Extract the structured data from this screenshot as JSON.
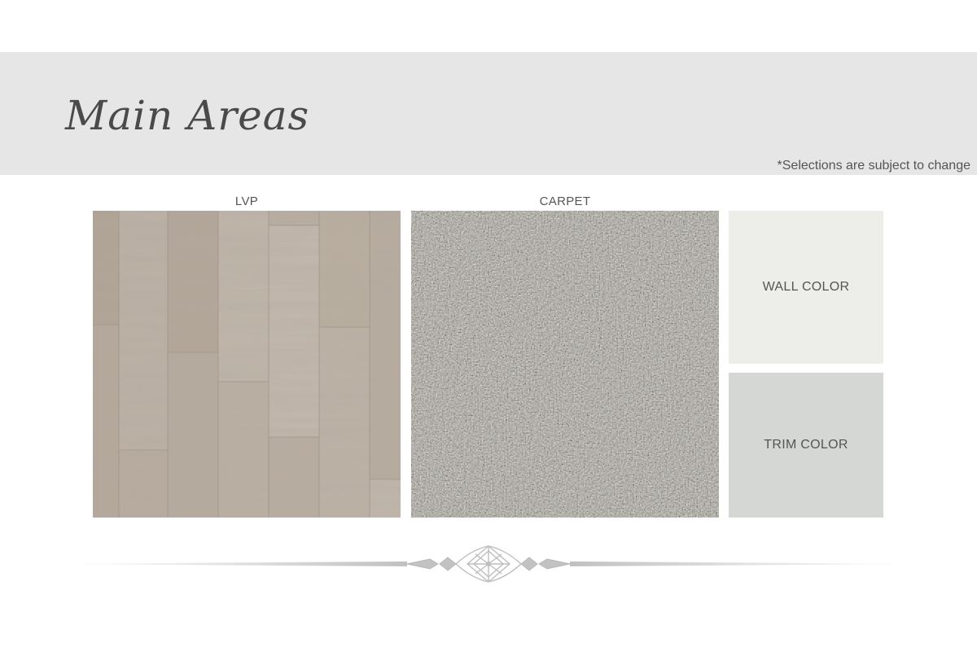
{
  "header": {
    "title": "Main Areas",
    "disclaimer": "*Selections are subject to change"
  },
  "swatches": [
    {
      "label": "LVP",
      "type": "wood-plank"
    },
    {
      "label": "CARPET",
      "type": "carpet-texture"
    }
  ],
  "color_blocks": [
    {
      "label": "WALL COLOR",
      "color": "#ededea"
    },
    {
      "label": "TRIM COLOR",
      "color": "#d4d7d4"
    }
  ],
  "colors": {
    "header_band": "#e6e6e6",
    "text": "#555555",
    "title": "#4a4a4a",
    "divider": "#c8c8c8"
  }
}
